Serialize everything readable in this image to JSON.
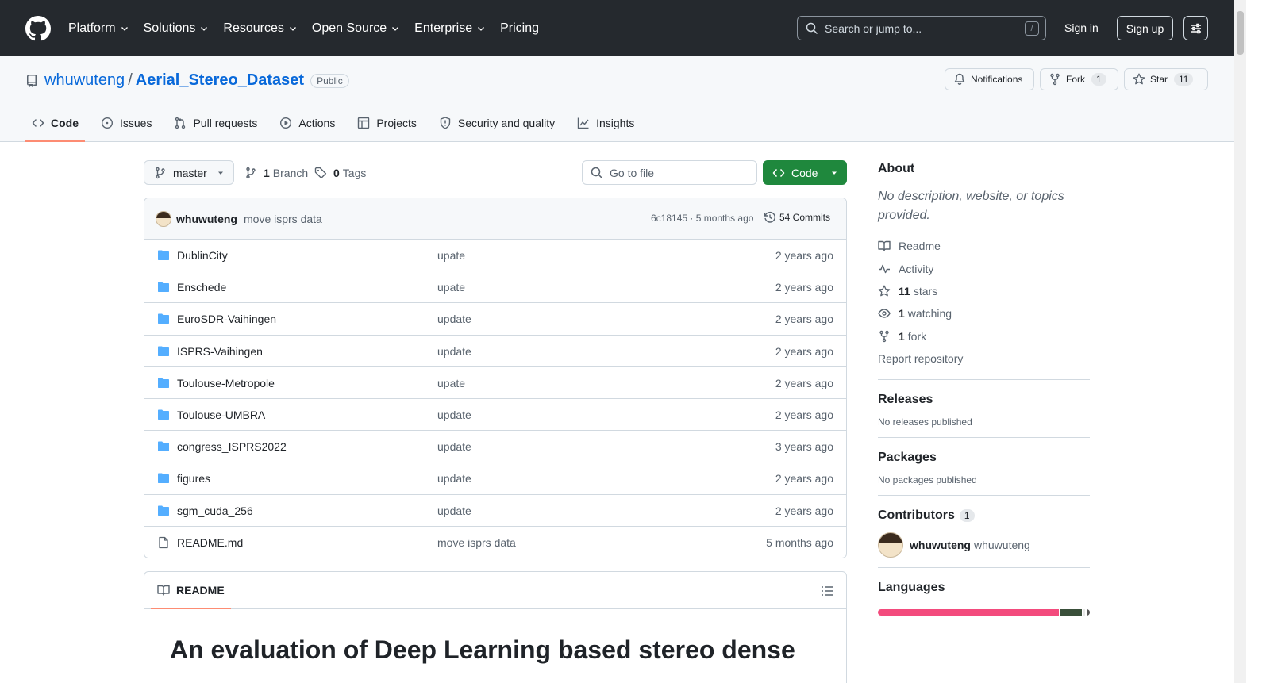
{
  "header": {
    "nav": [
      {
        "label": "Platform",
        "chevron": true
      },
      {
        "label": "Solutions",
        "chevron": true
      },
      {
        "label": "Resources",
        "chevron": true
      },
      {
        "label": "Open Source",
        "chevron": true
      },
      {
        "label": "Enterprise",
        "chevron": true
      },
      {
        "label": "Pricing",
        "chevron": false
      }
    ],
    "search_placeholder": "Search or jump to...",
    "search_shortcut": "/",
    "sign_in": "Sign in",
    "sign_up": "Sign up"
  },
  "repo": {
    "owner": "whuwuteng",
    "separator": "/",
    "name": "Aerial_Stereo_Dataset",
    "visibility": "Public",
    "notifications_label": "Notifications",
    "fork_label": "Fork",
    "fork_count": "1",
    "star_label": "Star",
    "star_count": "11"
  },
  "tabs": [
    {
      "label": "Code",
      "icon": "code-icon",
      "active": true
    },
    {
      "label": "Issues",
      "icon": "issue-icon",
      "active": false
    },
    {
      "label": "Pull requests",
      "icon": "pull-request-icon",
      "active": false
    },
    {
      "label": "Actions",
      "icon": "play-icon",
      "active": false
    },
    {
      "label": "Projects",
      "icon": "table-icon",
      "active": false
    },
    {
      "label": "Security and quality",
      "icon": "shield-icon",
      "active": false
    },
    {
      "label": "Insights",
      "icon": "graph-icon",
      "active": false
    }
  ],
  "toolbar": {
    "branch": "master",
    "branch_count": "1",
    "branch_label": "Branch",
    "tag_count": "0",
    "tag_label": "Tags",
    "goto_placeholder": "Go to file",
    "code_label": "Code"
  },
  "latest_commit": {
    "author": "whuwuteng",
    "message": "move isprs data",
    "sha_age": "6c18145 · 5 months ago",
    "commits_label": "54 Commits"
  },
  "files": [
    {
      "name": "DublinCity",
      "type": "folder",
      "message": "upate",
      "age": "2 years ago"
    },
    {
      "name": "Enschede",
      "type": "folder",
      "message": "upate",
      "age": "2 years ago"
    },
    {
      "name": "EuroSDR-Vaihingen",
      "type": "folder",
      "message": "update",
      "age": "2 years ago"
    },
    {
      "name": "ISPRS-Vaihingen",
      "type": "folder",
      "message": "update",
      "age": "2 years ago"
    },
    {
      "name": "Toulouse-Metropole",
      "type": "folder",
      "message": "upate",
      "age": "2 years ago"
    },
    {
      "name": "Toulouse-UMBRA",
      "type": "folder",
      "message": "update",
      "age": "2 years ago"
    },
    {
      "name": "congress_ISPRS2022",
      "type": "folder",
      "message": "update",
      "age": "3 years ago"
    },
    {
      "name": "figures",
      "type": "folder",
      "message": "update",
      "age": "2 years ago"
    },
    {
      "name": "sgm_cuda_256",
      "type": "folder",
      "message": "update",
      "age": "2 years ago"
    },
    {
      "name": "README.md",
      "type": "file",
      "message": "move isprs data",
      "age": "5 months ago"
    }
  ],
  "readme": {
    "tab_label": "README",
    "heading": "An evaluation of Deep Learning based stereo dense"
  },
  "sidebar": {
    "about_title": "About",
    "about_desc": "No description, website, or topics provided.",
    "links": [
      {
        "icon": "book-icon",
        "count": "",
        "label": "Readme"
      },
      {
        "icon": "pulse-icon",
        "count": "",
        "label": "Activity"
      },
      {
        "icon": "star-icon",
        "count": "11",
        "label": "stars"
      },
      {
        "icon": "eye-icon",
        "count": "1",
        "label": "watching"
      },
      {
        "icon": "fork-icon",
        "count": "1",
        "label": "fork"
      }
    ],
    "report": "Report repository",
    "releases_title": "Releases",
    "releases_note": "No releases published",
    "packages_title": "Packages",
    "packages_note": "No packages published",
    "contributors_title": "Contributors",
    "contributors_count": "1",
    "contributor_login": "whuwuteng",
    "contributor_name": "whuwuteng",
    "languages_title": "Languages",
    "languages_bar": [
      {
        "color": "#f34b7d",
        "share": 87.5
      },
      {
        "color": "#3a4f3a",
        "share": 10
      },
      {
        "color": "#e8e8e8",
        "share": 1
      },
      {
        "color": "#555555",
        "share": 1.5
      }
    ]
  },
  "colors": {
    "header_bg": "#25292e",
    "link": "#0969da",
    "primary_button": "#1f883d",
    "folder": "#54aeff",
    "active_tab_underline": "#fd8c73"
  }
}
